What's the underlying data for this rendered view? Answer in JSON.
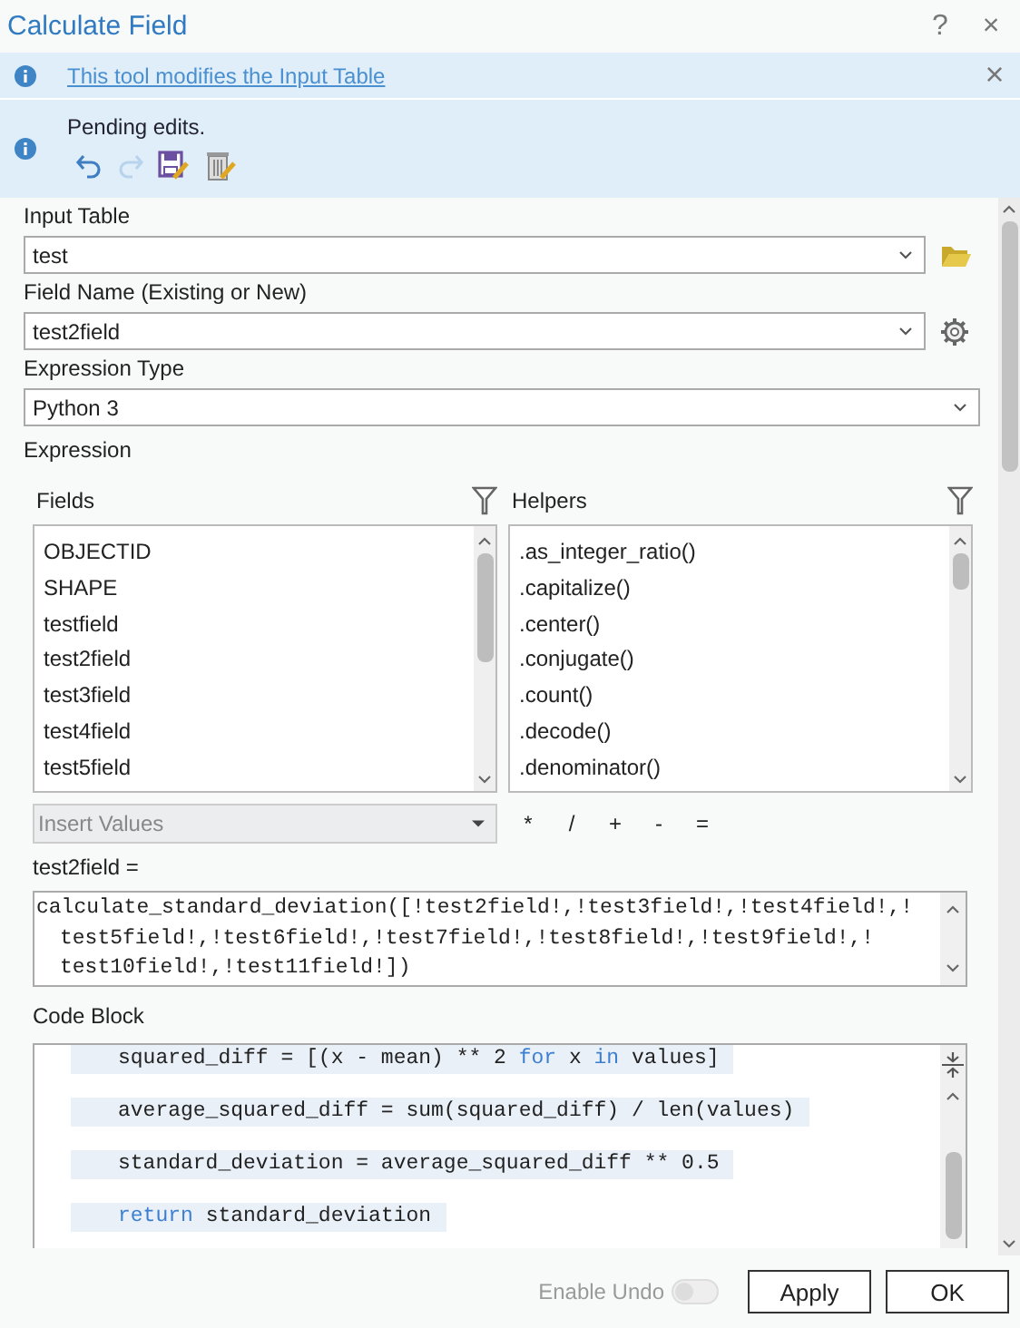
{
  "window": {
    "title": "Calculate Field",
    "help": "?",
    "close": "×"
  },
  "info_bar": {
    "link": "This tool modifies the Input Table",
    "close": "×"
  },
  "pending": {
    "message": "Pending edits.",
    "tools": [
      {
        "kind": "undo",
        "disabled": false
      },
      {
        "kind": "redo",
        "disabled": true
      },
      {
        "kind": "save",
        "disabled": false
      },
      {
        "kind": "discard",
        "disabled": false
      }
    ]
  },
  "input_table": {
    "label": "Input Table",
    "value": "test"
  },
  "field_name": {
    "label": "Field Name (Existing or New)",
    "value": "test2field"
  },
  "expression_type": {
    "label": "Expression Type",
    "value": "Python 3"
  },
  "expression": {
    "label": "Expression",
    "fields": {
      "label": "Fields",
      "items": [
        "OBJECTID",
        "SHAPE",
        "testfield",
        "test2field",
        "test3field",
        "test4field",
        "test5field"
      ]
    },
    "helpers": {
      "label": "Helpers",
      "items": [
        ".as_integer_ratio()",
        ".capitalize()",
        ".center()",
        ".conjugate()",
        ".count()",
        ".decode()",
        ".denominator()"
      ]
    },
    "insert_values": {
      "placeholder": "Insert Values",
      "disabled": true
    },
    "operators": [
      "*",
      "/",
      "+",
      "-",
      "="
    ],
    "target_label": "test2field =",
    "lines": [
      "calculate_standard_deviation([!test2field!,!test3field!,!test4field!,!",
      "test5field!,!test6field!,!test7field!,!test8field!,!test9field!,!",
      "test10field!,!test11field!])"
    ]
  },
  "code_block": {
    "label": "Code Block",
    "lines": [
      {
        "tokens": [
          {
            "text": "squared_diff = [(x - mean) ** 2 ",
            "kind": "plain"
          },
          {
            "text": "for",
            "kind": "keyword"
          },
          {
            "text": " x ",
            "kind": "plain"
          },
          {
            "text": "in",
            "kind": "keyword"
          },
          {
            "text": " values]",
            "kind": "plain"
          }
        ]
      },
      {
        "tokens": [
          {
            "text": "average_squared_diff = sum(squared_diff) / len(values)",
            "kind": "plain"
          }
        ]
      },
      {
        "tokens": [
          {
            "text": "standard_deviation = average_squared_diff ** 0.5",
            "kind": "plain"
          }
        ]
      },
      {
        "tokens": [
          {
            "text": "return",
            "kind": "keyword"
          },
          {
            "text": " standard_deviation",
            "kind": "plain"
          }
        ]
      }
    ]
  },
  "enable_undo": {
    "label": "Enable Undo",
    "on": false,
    "disabled": true
  },
  "buttons": [
    "Apply",
    "OK"
  ]
}
